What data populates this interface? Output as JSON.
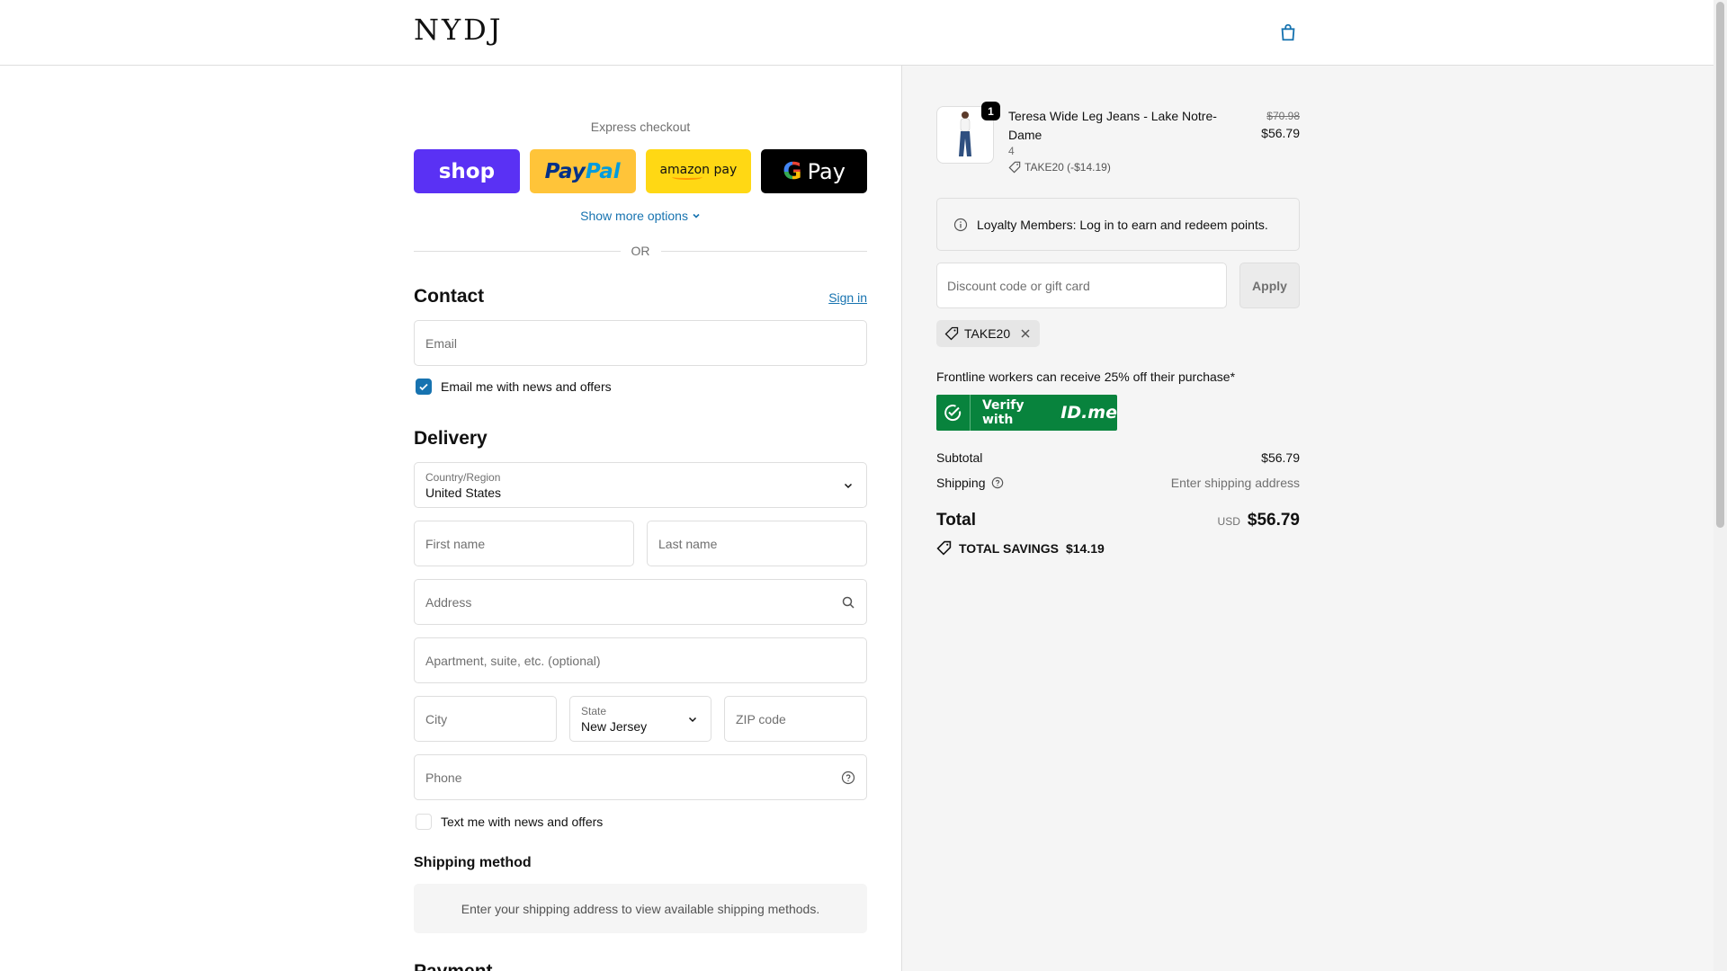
{
  "header": {
    "logo": "NYDJ",
    "cart_icon": "shopping-bag-icon"
  },
  "express": {
    "title": "Express checkout",
    "buttons": {
      "shop": "shop",
      "paypal_1": "Pay",
      "paypal_2": "Pal",
      "amazon": "amazon pay",
      "gpay": "Pay"
    },
    "show_more": "Show more options",
    "or": "OR"
  },
  "contact": {
    "title": "Contact",
    "signin": "Sign in",
    "email_placeholder": "Email",
    "news_label": "Email me with news and offers",
    "news_checked": true
  },
  "delivery": {
    "title": "Delivery",
    "country_label": "Country/Region",
    "country_value": "United States",
    "first_name_placeholder": "First name",
    "last_name_placeholder": "Last name",
    "address_placeholder": "Address",
    "apartment_placeholder": "Apartment, suite, etc. (optional)",
    "city_placeholder": "City",
    "state_label": "State",
    "state_value": "New Jersey",
    "zip_placeholder": "ZIP code",
    "phone_placeholder": "Phone",
    "text_label": "Text me with news and offers",
    "text_checked": false
  },
  "shipping_method": {
    "title": "Shipping method",
    "note": "Enter your shipping address to view available shipping methods."
  },
  "payment": {
    "title": "Payment"
  },
  "summary": {
    "product": {
      "name": "Teresa Wide Leg Jeans - Lake Notre-Dame",
      "variant": "4",
      "quantity": "1",
      "discount": "TAKE20 (-$14.19)",
      "old_price": "$70.98",
      "new_price": "$56.79"
    },
    "loyalty": "Loyalty Members: Log in to earn and redeem points.",
    "discount_placeholder": "Discount code or gift card",
    "apply": "Apply",
    "applied_code": "TAKE20",
    "frontline": "Frontline workers can receive 25% off their purchase*",
    "idme_text": "Verify with",
    "idme_brand": "ID.me",
    "subtotal_label": "Subtotal",
    "subtotal_value": "$56.79",
    "shipping_label": "Shipping",
    "shipping_value": "Enter shipping address",
    "total_label": "Total",
    "total_currency": "USD",
    "total_value": "$56.79",
    "savings_label": "TOTAL SAVINGS",
    "savings_value": "$14.19"
  },
  "colors": {
    "accent": "#1773b0",
    "shop": "#5a31f4",
    "paypal": "#ffc439",
    "amazon": "#ffd814",
    "idme": "#08833d"
  }
}
